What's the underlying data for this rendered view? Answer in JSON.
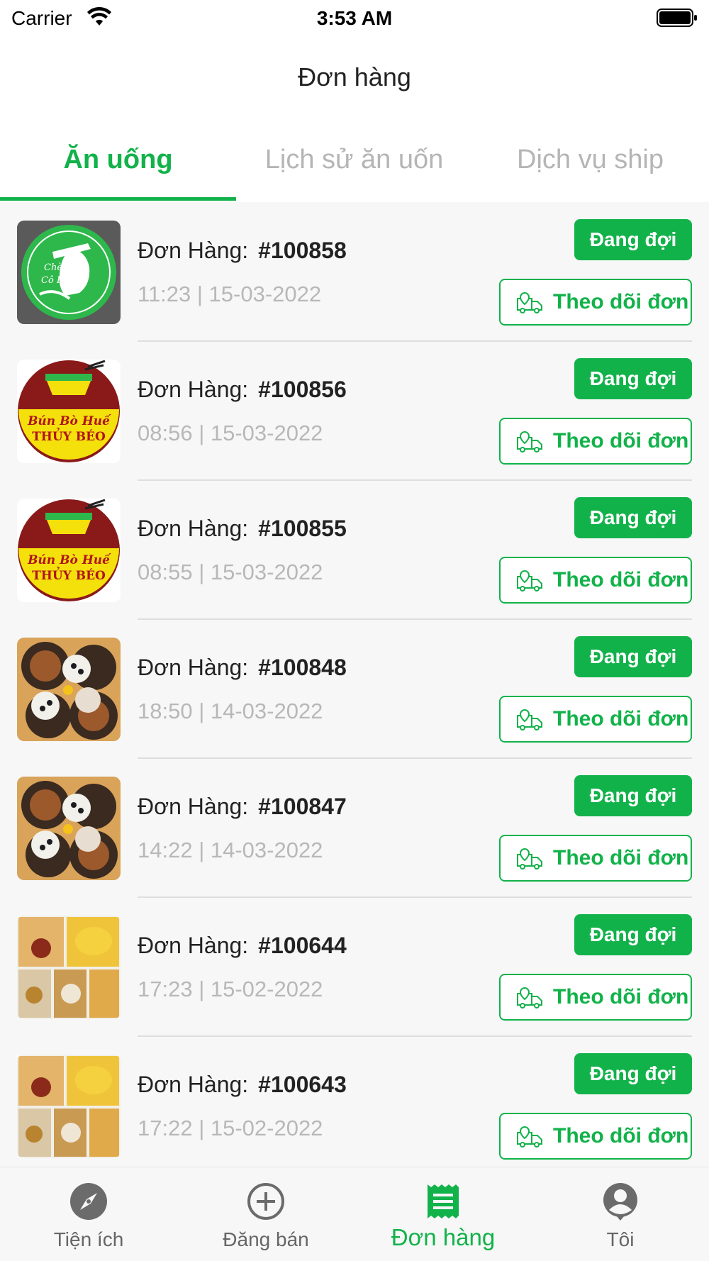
{
  "status_bar": {
    "carrier": "Carrier",
    "time": "3:53 AM"
  },
  "header": {
    "title": "Đơn hàng"
  },
  "tabs": [
    {
      "label": "Ăn uống",
      "active": true
    },
    {
      "label": "Lịch sử ăn uốn",
      "active": false
    },
    {
      "label": "Dịch vụ ship",
      "active": false
    }
  ],
  "colors": {
    "accent": "#12b24a",
    "muted_text": "#b8b8b8",
    "background": "#f7f7f7"
  },
  "orders": [
    {
      "label": "Đơn Hàng:",
      "number": "#100858",
      "time": "11:23 | 15-03-2022",
      "status": "Đang đợi",
      "track_label": "Theo dõi đơn",
      "thumb": "che-co-ba-logo"
    },
    {
      "label": "Đơn Hàng:",
      "number": "#100856",
      "time": "08:56 | 15-03-2022",
      "status": "Đang đợi",
      "track_label": "Theo dõi đơn",
      "thumb": "bun-bo-hue-logo",
      "thumb_text": [
        "Bún Bò Huế",
        "THỦY BÉO"
      ]
    },
    {
      "label": "Đơn Hàng:",
      "number": "#100855",
      "time": "08:55 | 15-03-2022",
      "status": "Đang đợi",
      "track_label": "Theo dõi đơn",
      "thumb": "bun-bo-hue-logo",
      "thumb_text": [
        "Bún Bò Huế",
        "THỦY BÉO"
      ]
    },
    {
      "label": "Đơn Hàng:",
      "number": "#100848",
      "time": "18:50 | 14-03-2022",
      "status": "Đang đợi",
      "track_label": "Theo dõi đơn",
      "thumb": "dessert-photo"
    },
    {
      "label": "Đơn Hàng:",
      "number": "#100847",
      "time": "14:22 | 14-03-2022",
      "status": "Đang đợi",
      "track_label": "Theo dõi đơn",
      "thumb": "dessert-photo"
    },
    {
      "label": "Đơn Hàng:",
      "number": "#100644",
      "time": "17:23 | 15-02-2022",
      "status": "Đang đợi",
      "track_label": "Theo dõi đơn",
      "thumb": "chicken-collage-photo"
    },
    {
      "label": "Đơn Hàng:",
      "number": "#100643",
      "time": "17:22 | 15-02-2022",
      "status": "Đang đợi",
      "track_label": "Theo dõi đơn",
      "thumb": "chicken-collage-photo"
    }
  ],
  "tabbar": [
    {
      "label": "Tiện ích",
      "icon": "compass-icon",
      "active": false
    },
    {
      "label": "Đăng bán",
      "icon": "plus-circle-icon",
      "active": false
    },
    {
      "label": "Đơn hàng",
      "icon": "receipt-icon",
      "active": true
    },
    {
      "label": "Tôi",
      "icon": "user-icon",
      "active": false
    }
  ]
}
